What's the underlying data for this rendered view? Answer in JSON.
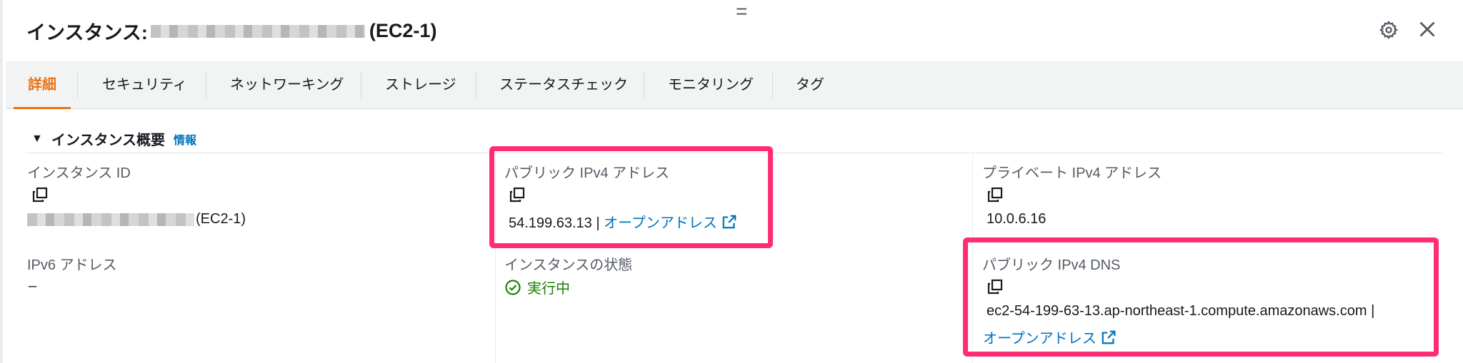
{
  "header": {
    "title_prefix": "インスタンス:",
    "title_suffix": "(EC2-1)",
    "drag_handle": "="
  },
  "tabs": [
    "詳細",
    "セキュリティ",
    "ネットワーキング",
    "ストレージ",
    "ステータスチェック",
    "モニタリング",
    "タグ"
  ],
  "section": {
    "title": "インスタンス概要",
    "info_link": "情報"
  },
  "fields": {
    "instance_id": {
      "label": "インスタンス ID",
      "value_suffix": "(EC2-1)"
    },
    "public_ipv4": {
      "label": "パブリック IPv4 アドレス",
      "value": "54.199.63.13 |",
      "link": "オープンアドレス"
    },
    "private_ipv4": {
      "label": "プライベート IPv4 アドレス",
      "value": "10.0.6.16"
    },
    "ipv6": {
      "label": "IPv6 アドレス",
      "value": "–"
    },
    "instance_state": {
      "label": "インスタンスの状態",
      "value": "実行中"
    },
    "public_dns": {
      "label": "パブリック IPv4 DNS",
      "value": "ec2-54-199-63-13.ap-northeast-1.compute.amazonaws.com |",
      "link": "オープンアドレス"
    }
  },
  "colors": {
    "accent": "#ec7211",
    "link": "#0073bb",
    "success": "#1d8102",
    "highlight": "#ff2d6f"
  },
  "icons": [
    "gear-icon",
    "close-icon",
    "copy-icon",
    "external-link-icon",
    "check-circle-icon",
    "caret-down-icon"
  ]
}
